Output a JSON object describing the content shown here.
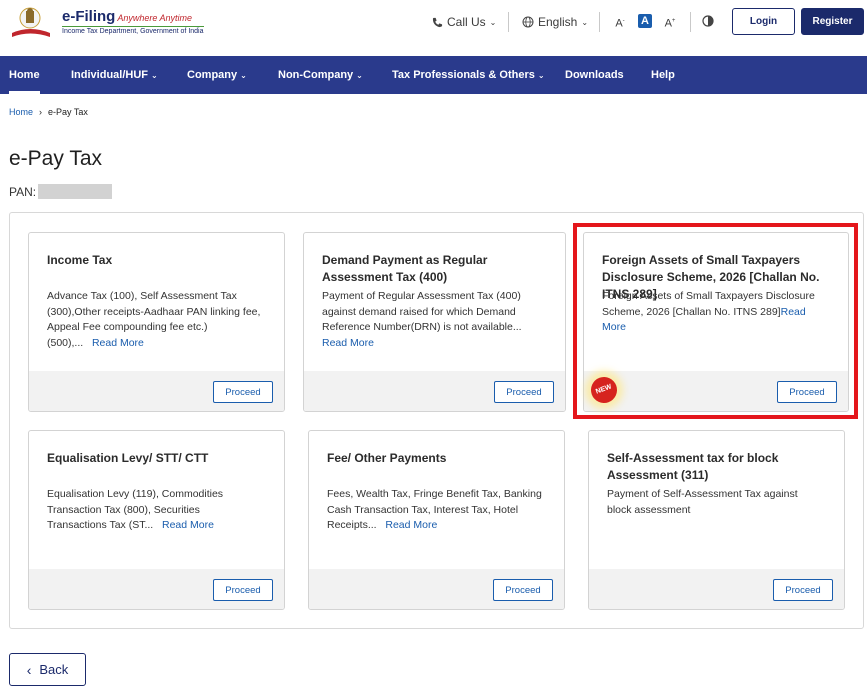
{
  "header": {
    "brand_title": "e-Filing",
    "brand_tag": "Anywhere Anytime",
    "brand_sub": "Income Tax Department, Government of India",
    "call_us": "Call Us",
    "language": "English",
    "font_small": "A",
    "font_normal": "A",
    "font_large": "A",
    "login": "Login",
    "register": "Register"
  },
  "nav": {
    "items": [
      {
        "label": "Home"
      },
      {
        "label": "Individual/HUF"
      },
      {
        "label": "Company"
      },
      {
        "label": "Non-Company"
      },
      {
        "label": "Tax Professionals & Others"
      },
      {
        "label": "Downloads"
      },
      {
        "label": "Help"
      }
    ]
  },
  "breadcrumb": {
    "home": "Home",
    "current": "e-Pay Tax"
  },
  "page": {
    "title": "e-Pay Tax",
    "pan_label": "PAN:"
  },
  "cards": [
    {
      "title": "Income Tax",
      "desc": "Advance Tax (100), Self Assessment Tax (300),Other receipts-Aadhaar PAN linking fee, Appeal Fee compounding fee etc.) (500),...",
      "more": "Read More",
      "button": "Proceed"
    },
    {
      "title": "Demand Payment as Regular Assessment Tax (400)",
      "desc": "Payment of Regular Assessment Tax (400) against demand raised for which Demand Reference Number(DRN) is not available...",
      "more": "Read More",
      "button": "Proceed"
    },
    {
      "title": "Foreign Assets of Small Taxpayers Disclosure Scheme, 2026 [Challan No. ITNS 289]",
      "desc": "Foreign Assets of Small Taxpayers Disclosure Scheme, 2026 [Challan No. ITNS 289]",
      "more": "Read More",
      "button": "Proceed",
      "badge": "NEW"
    },
    {
      "title": "Equalisation Levy/ STT/ CTT",
      "desc": "Equalisation Levy (119), Commodities Transaction Tax (800), Securities Transactions Tax (ST...",
      "more": "Read More",
      "button": "Proceed"
    },
    {
      "title": "Fee/ Other Payments",
      "desc": "Fees, Wealth Tax, Fringe Benefit Tax, Banking Cash Transaction Tax, Interest Tax, Hotel Receipts...",
      "more": "Read More",
      "button": "Proceed"
    },
    {
      "title": "Self-Assessment tax for block Assessment (311)",
      "desc": "Payment of Self-Assessment Tax against block assessment",
      "more": "",
      "button": "Proceed"
    }
  ],
  "back_label": "Back",
  "colors": {
    "primary": "#2a3a8c",
    "link": "#1a5dad",
    "highlight": "#e4161b"
  }
}
